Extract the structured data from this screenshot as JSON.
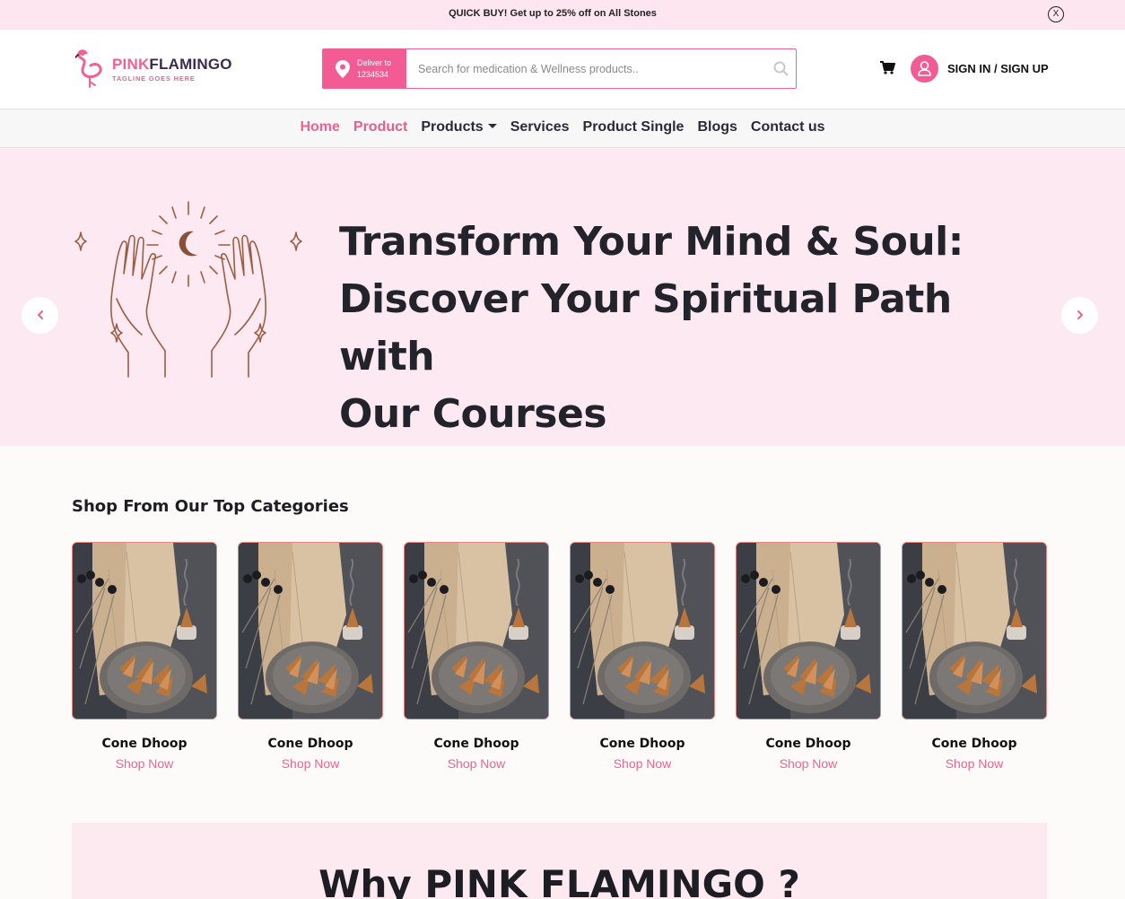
{
  "announcement": {
    "text": "QUICK BUY! Get up to 25% off on All Stones",
    "close_label": "X"
  },
  "brand": {
    "name_part1": "PINK",
    "name_part2": "FLAMINGO",
    "tagline": "TAGLINE GOES HERE"
  },
  "search": {
    "deliver_label": "Deliver to",
    "deliver_code": "1234534",
    "placeholder": "Search for medication & Wellness products..",
    "value": ""
  },
  "account": {
    "signin_label": "SIGN IN / SIGN UP"
  },
  "nav": {
    "items": [
      {
        "label": "Home"
      },
      {
        "label": "Product"
      },
      {
        "label": "Products"
      },
      {
        "label": "Services"
      },
      {
        "label": "Product Single"
      },
      {
        "label": "Blogs"
      },
      {
        "label": "Contact us"
      }
    ]
  },
  "hero": {
    "line1": "Transform Your Mind & Soul:",
    "line2": "Discover Your Spiritual Path with",
    "line3": "Our Courses"
  },
  "categories": {
    "title": "Shop From Our Top Categories",
    "items": [
      {
        "name": "Cone Dhoop",
        "link": "Shop Now"
      },
      {
        "name": "Cone Dhoop",
        "link": "Shop Now"
      },
      {
        "name": "Cone Dhoop",
        "link": "Shop Now"
      },
      {
        "name": "Cone Dhoop",
        "link": "Shop Now"
      },
      {
        "name": "Cone Dhoop",
        "link": "Shop Now"
      },
      {
        "name": "Cone Dhoop",
        "link": "Shop Now"
      }
    ]
  },
  "why": {
    "title": "Why PINK FLAMINGO ?"
  },
  "colors": {
    "accent": "#f06292",
    "hero_bg": "#fde9f1",
    "topbar_bg": "#fde6ef",
    "text_dark": "#23232c"
  }
}
